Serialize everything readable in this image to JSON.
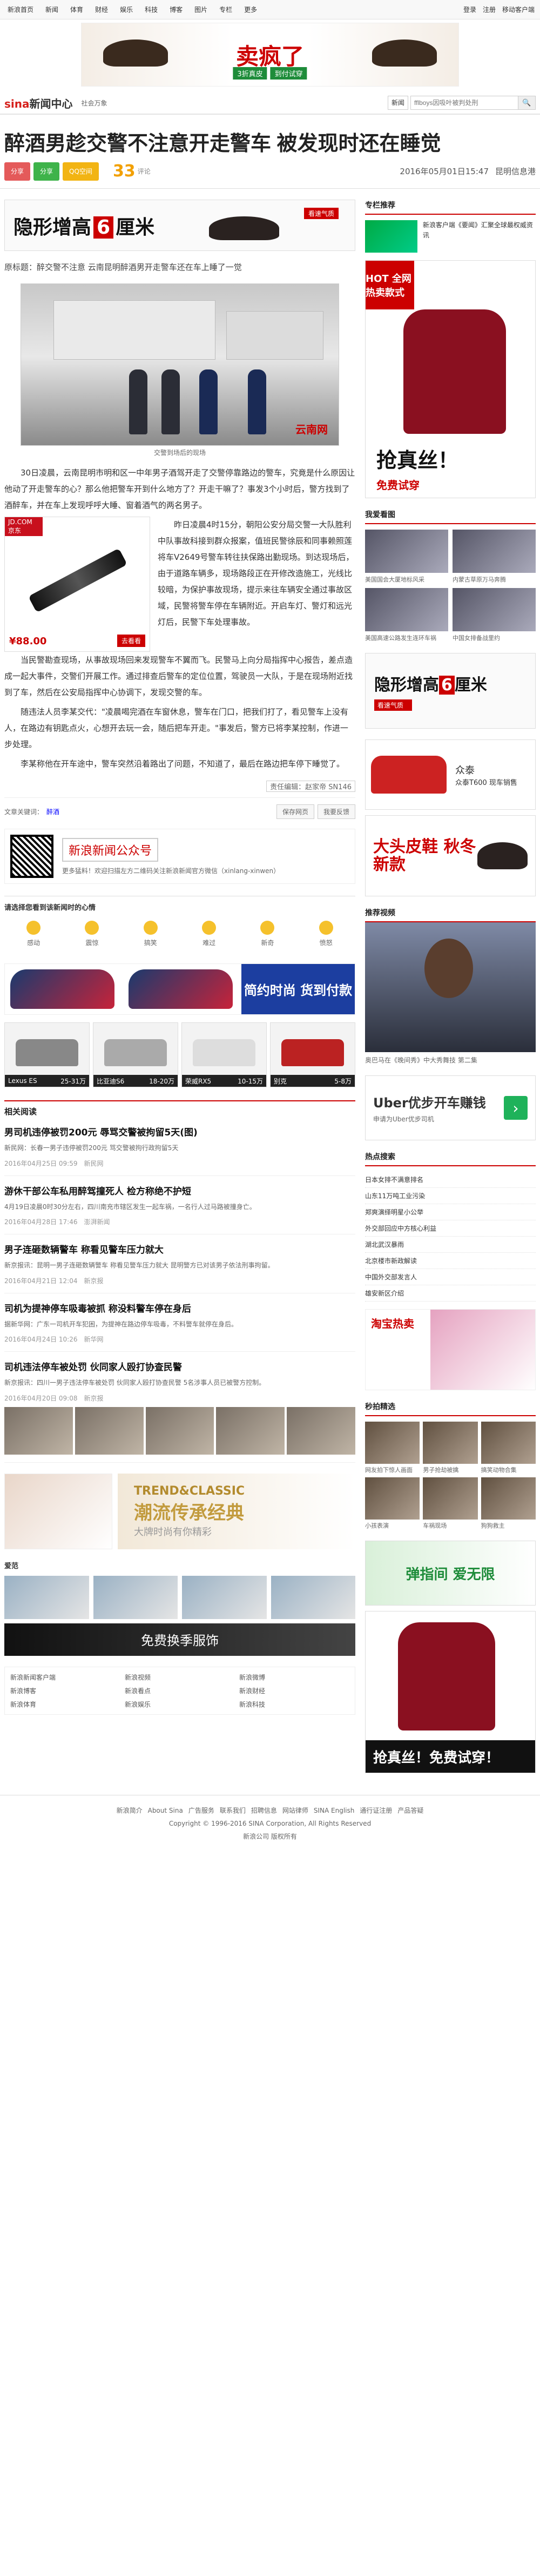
{
  "topbar": {
    "nav": [
      "新浪首页",
      "新闻",
      "体育",
      "财经",
      "娱乐",
      "科技",
      "博客",
      "图片",
      "专栏",
      "更多"
    ],
    "login": "登录",
    "register": "注册",
    "mobile": "移动客户端"
  },
  "banner": {
    "big": "卖疯了",
    "sub1": "3折真皮",
    "sub2": "到付试穿"
  },
  "channel": {
    "logo_a": "sina",
    "logo_b": "新闻中心",
    "cat": "社会万象",
    "select": "新闻",
    "search_placeholder": "fflboys因吸叶被判处刑"
  },
  "article": {
    "title": "醉酒男趁交警不注意开走警车 被发现时还在睡觉",
    "share_weibo": "分享",
    "share_wechat": "分享",
    "share_qzone": "QQ空间",
    "comment_count": "33",
    "comment_label": "评论",
    "time": "2016年05月01日15:47",
    "source": "昆明信息港",
    "ad_title_a": "隐形增高",
    "ad_title_num": "6",
    "ad_title_b": "厘米",
    "ad_tag": "看速气质",
    "lead": "原标题：醉交警不注意 云南昆明醉酒男开走警车还在车上睡了一觉",
    "photo_wm": "云南网",
    "photo_cap": "交警到场后的现场",
    "p1": "30日凌晨，云南昆明市明和区一中年男子酒驾开走了交警停靠路边的警车，究竟是什么原因让他动了开走警车的心？那么他把警车开到什么地方了？开走干嘛了？事发3个小时后，警方找到了酒醉车，并在车上发现呼呼大睡、窗着酒气的两名男子。",
    "p2": "昨日凌晨4时15分，朝阳公安分局交警一大队胜利中队事故科接到群众报案，值班民警徐辰和同事赖照莲将车V2649号警车转往扶保路出勤现场。到达现场后，由于道路车辆多，现场路段正在开修改造施工，光线比较暗，为保护事故现场，提示来往车辆安全通过事故区域，民警将警车停在车辆附近。开启车灯、警灯和远光灯后，民警下车处理事故。",
    "p3": "当民警勘查现场，从事故现场回来发现警车不翼而飞。民警马上向分局指挥中心报告，差点造成一起大事件，交警们开展工作。通过排查后警车的定位位置，驾驶员一大队，于是在现场附近找到了车，然后在公安局指挥中心协调下，发现交警的车。",
    "p4": "随违法人员李某交代：\"凌晨喝完酒在车窗休息，警车在门口，把我们打了，看见警车上没有人，在路边有钥匙点火，心想开去玩一会，随后把车开走。\"事发后，警方已将李某控制，作进一步处理。",
    "p5": "李某称他在开车途中，警车突然沿着路出了问题，不知道了，最后在路边把车停下睡觉了。",
    "editor_label": "责任编辑：赵家帝 SN146",
    "jd_hd": "JD.COM 京东",
    "jd_price": "¥88.00",
    "jd_buy": "去看看"
  },
  "tags": {
    "label": "文章关键词：",
    "tag": "醉酒",
    "btn1": "保存网页",
    "btn2": "我要反馈"
  },
  "qr": {
    "h": "新浪新闻公众号",
    "s": "更多猛料！欢迎扫描左方二维码关注新浪新闻官方微信（xinlang-xinwen）"
  },
  "mood": {
    "h": "请选择您看到该新闻时的心情",
    "faces": [
      "感动",
      "震惊",
      "搞笑",
      "难过",
      "新奇",
      "愤怒"
    ]
  },
  "shoeads": {
    "r": "简约时尚 货到付款"
  },
  "cars": [
    {
      "n": "Lexus ES",
      "p": "25-31万"
    },
    {
      "n": "比亚迪S6",
      "p": "18-20万"
    },
    {
      "n": "荣威RX5",
      "p": "10-15万"
    },
    {
      "n": "别克",
      "p": "5-8万"
    }
  ],
  "related": {
    "title": "相关阅读"
  },
  "news": [
    {
      "t": "男司机违停被罚200元 辱骂交警被拘留5天(图)",
      "d": "新民网：长春一男子违停被罚200元 骂交警被拘行政拘留5天 ",
      "m": "2016年04月25日 09:59",
      "src": "新民网"
    },
    {
      "t": "游休干部公车私用醉驾撞死人 检方称绝不护短",
      "d": "4月19日凌晨0时30分左右，四川南充市辖区发生一起车祸，一名行人过马路被撞身亡。",
      "m": "2016年04月28日 17:46",
      "src": "澎湃新闻"
    },
    {
      "t": "男子连砸数辆警车 称看见警车压力就大",
      "d": "新京报讯：昆明一男子连砸数辆警车 称看见警车压力就大 昆明警方已对该男子依法刑事拘留。",
      "m": "2016年04月21日 12:04",
      "src": "新京报"
    },
    {
      "t": "司机为提神停车吸毒被抓 称没料警车停在身后",
      "d": "据新华网：广东一司机开车犯困，为提神在路边停车吸毒，不料警车就停在身后。",
      "m": "2016年04月24日 10:26",
      "src": "新华网"
    },
    {
      "t": "司机违法停车被处罚 伙同家人殴打协查民警",
      "d": "新京报讯：四川一男子违法停车被处罚 伙同家人殴打协查民警 5名涉事人员已被警方控制。",
      "m": "2016年04月20日 09:08",
      "src": "新京报"
    }
  ],
  "promo": {
    "a": "TREND&CLASSIC",
    "b": "潮流传承经典",
    "c": "大牌时尚有你精彩"
  },
  "fashion": {
    "h": "爱范",
    "ad": "免费换季服饰"
  },
  "links": [
    "新浪新闻客户端",
    "新浪视频",
    "新浪微博",
    "新浪博客",
    "新浪看点",
    "新浪财经",
    "新浪体育",
    "新浪娱乐",
    "新浪科技"
  ],
  "side": {
    "rec_h": "专栏推荐",
    "rec_title": "新浪客户端《要闻》汇聚全球最权威资讯",
    "hot_tag": "HOT 全网热卖款式",
    "tshirt_a": "抢真丝！",
    "tshirt_b": "免费试穿",
    "gallery_h": "我爱看图",
    "gallery": [
      "美国国会大厦地标风采",
      "内蒙古草原万马奔腾",
      "美国高速公路发生连环车祸",
      "中国女排备战里约"
    ],
    "sad_t_a": "隐形增高",
    "sad_t_num": "6",
    "sad_t_b": "厘米",
    "sad_tag": "看速气质",
    "suv_n": "众泰",
    "suv_t": "众泰T600 现车销售",
    "pdr_t": "大头皮鞋 秋冬新款",
    "video_h": "推荐视频",
    "video_c": "奥巴马在《晚间秀》中大秀舞技 第二集",
    "uber_a": "Uber优步开车赚钱",
    "uber_b": "申请为Uber优步司机",
    "hot_h": "热点搜索",
    "hot": [
      "日本女排不满意排名",
      "山东11万吨工业污染",
      "郑爽演绎明星小公举",
      "外交部回应中方核心利益",
      "湖北武汉暴雨",
      "北京楼市新政解读",
      "中国外交部发言人",
      "雄安新区介绍"
    ],
    "stat_t": "淘宝热卖",
    "sec_h": "秒拍精选",
    "sec": [
      "网友拍下惊人画面",
      "男子抢劫被擒",
      "搞笑动物合集",
      "小孩表演",
      "车祸现场",
      "狗狗救主"
    ],
    "green": "弹指间 爱无限",
    "tshirt2_cta": "抢真丝！免费试穿！"
  },
  "footer": {
    "links": [
      "新浪简介",
      "About Sina",
      "广告服务",
      "联系我们",
      "招聘信息",
      "网站律师",
      "SINA English",
      "通行证注册",
      "产品答疑"
    ],
    "copy": "Copyright © 1996-2016 SINA Corporation, All Rights Reserved",
    "corp": "新浪公司 版权所有"
  }
}
